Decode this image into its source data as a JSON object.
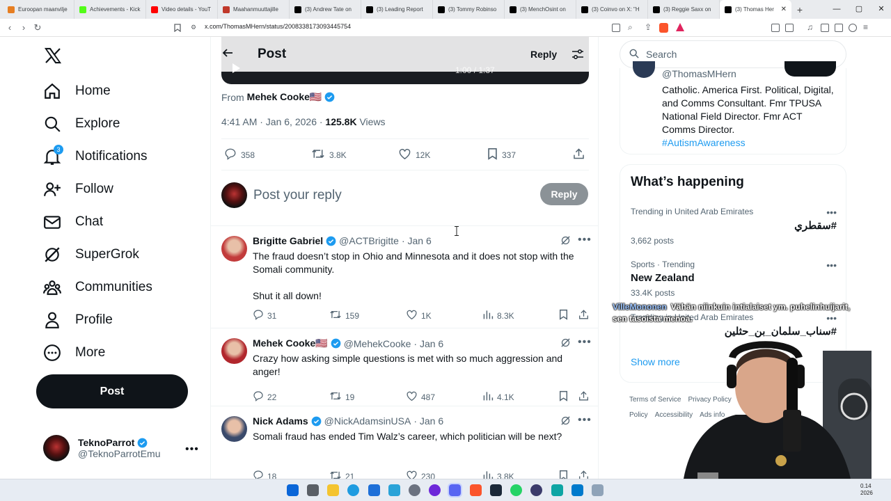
{
  "browser": {
    "tabs": [
      {
        "label": "Euroopan maanvilje",
        "color": "#e67e22"
      },
      {
        "label": "Achievements - Kick",
        "color": "#53fc18"
      },
      {
        "label": "Video details - YouT",
        "color": "#ff0000"
      },
      {
        "label": "Maahanmuuttajille",
        "color": "#c0392b"
      },
      {
        "label": "(3) Andrew Tate on",
        "color": "#000000"
      },
      {
        "label": "(3) Leading Report",
        "color": "#000000"
      },
      {
        "label": "(3) Tommy Robinso",
        "color": "#000000"
      },
      {
        "label": "(3) MenchOsint on",
        "color": "#000000"
      },
      {
        "label": "(3) Coinvo on X: \"H",
        "color": "#000000"
      },
      {
        "label": "(3) Reggie Saxx on",
        "color": "#000000"
      },
      {
        "label": "(3) Thomas Her",
        "color": "#000000"
      }
    ],
    "url": "x.com/ThomasMHern/status/2008338173093445754"
  },
  "nav": {
    "items": [
      {
        "label": "Home",
        "icon": "home-icon"
      },
      {
        "label": "Explore",
        "icon": "search-icon"
      },
      {
        "label": "Notifications",
        "icon": "bell-icon",
        "badge": "3"
      },
      {
        "label": "Follow",
        "icon": "add-person-icon"
      },
      {
        "label": "Chat",
        "icon": "mail-icon"
      },
      {
        "label": "SuperGrok",
        "icon": "grok-icon"
      },
      {
        "label": "Communities",
        "icon": "communities-icon"
      },
      {
        "label": "Profile",
        "icon": "person-icon"
      },
      {
        "label": "More",
        "icon": "more-circle-icon"
      }
    ],
    "post_label": "Post",
    "account": {
      "name": "TeknoParrot",
      "handle": "@TeknoParrotEmu"
    }
  },
  "main": {
    "header_title": "Post",
    "header_reply": "Reply",
    "video_time": "1:00 / 1:37",
    "from_label": "From",
    "from_name": "Mehek Cooke🇺🇸",
    "meta_time": "4:41 AM · Jan 6, 2026 ·",
    "meta_views_count": "125.8K",
    "meta_views_label": "Views",
    "stats": {
      "replies": "358",
      "reposts": "3.8K",
      "likes": "12K",
      "bookmarks": "337"
    },
    "reply_placeholder": "Post your reply",
    "reply_button": "Reply",
    "replies": [
      {
        "name": "Brigitte Gabriel",
        "handle": "@ACTBrigitte",
        "date": "· Jan 6",
        "text": "The fraud doesn’t stop in Ohio and Minnesota and it does not stop with the Somali community.\n\nShut it all down!",
        "replies": "31",
        "reposts": "159",
        "likes": "1K",
        "views": "8.3K"
      },
      {
        "name": "Mehek Cooke🇺🇸",
        "handle": "@MehekCooke",
        "date": "· Jan 6",
        "text": "Crazy how asking simple questions is met with so much aggression and anger!",
        "replies": "22",
        "reposts": "19",
        "likes": "487",
        "views": "4.1K"
      },
      {
        "name": "Nick Adams",
        "handle": "@NickAdamsinUSA",
        "date": "· Jan 6",
        "text": "Somali fraud has ended Tim Walz’s career, which politician will be next?",
        "replies": "18",
        "reposts": "21",
        "likes": "230",
        "views": "3.8K"
      }
    ]
  },
  "right": {
    "search_placeholder": "Search",
    "bio_handle": "@ThomasMHern",
    "bio_text": "Catholic. America First. Political, Digital, and Comms Consultant. Fmr TPUSA National Field Director. Fmr ACT Comms Director.",
    "bio_tag": "#AutismAwareness",
    "trends_title": "What’s happening",
    "trends": [
      {
        "category": "Trending in United Arab Emirates",
        "name": "#سقطري",
        "count": "3,662 posts"
      },
      {
        "category": "Sports · Trending",
        "name": "New Zealand",
        "count": "33.4K posts"
      },
      {
        "category": "Trending in United Arab Emirates",
        "name": "#سناب_سلمان_بن_حثلين",
        "count": ""
      }
    ],
    "show_more": "Show more",
    "footer": [
      "Terms of Service",
      "Privacy Policy",
      "Cookie Policy",
      "Accessibility",
      "Ads info"
    ]
  },
  "overlay": {
    "chat_user": "VilleMononen",
    "chat_text": "Vähän niinkuin intialaiset ym. puhelinhuijarit, sen tasoista menoa."
  },
  "taskbar": {
    "clock_time": "0.14",
    "clock_year": "2026"
  },
  "colors": {
    "accent": "#1d9bf0",
    "text": "#0f1419",
    "muted": "#536471"
  }
}
